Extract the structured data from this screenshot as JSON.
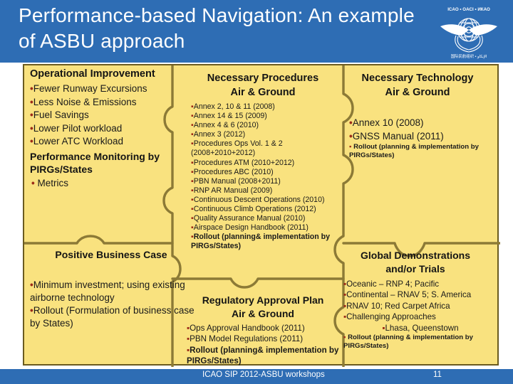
{
  "header": {
    "title": "Performance-based Navigation: An example of ASBU approach",
    "logo_icon": "icao-emblem-icon"
  },
  "colors": {
    "header_blue": "#2E6DB4",
    "panel_yellow": "#F9E27F",
    "panel_border": "#6B5B20",
    "bullet_red": "#9C2B17",
    "text_dark": "#141414"
  },
  "pieces": {
    "operational_improvement": {
      "heading": "Operational Improvement",
      "items": [
        "Fewer Runway Excursions",
        "Less Noise & Emissions",
        "Fuel Savings",
        "Lower Pilot workload",
        "Lower ATC Workload"
      ],
      "heading2": "Performance Monitoring by PIRGs/States",
      "items2": [
        "Metrics"
      ]
    },
    "business_case": {
      "heading": "Positive Business Case",
      "items": [
        "Minimum investment; using existing airborne technology",
        "Rollout (Formulation of business case by States)"
      ]
    },
    "necessary_procedures": {
      "heading_line1": "Necessary Procedures",
      "heading_line2": "Air & Ground",
      "items": [
        "Annex 2, 10 & 11 (2008)",
        "Annex 14 & 15 (2009)",
        "Annex 4 & 6 (2010)",
        "Annex 3 (2012)",
        "Procedures Ops Vol. 1 & 2 (2008+2010+2012)",
        "Procedures ATM (2010+2012)",
        "Procedures ABC (2010)",
        "PBN Manual (2008+2011)",
        "RNP AR Manual (2009)",
        "Continuous Descent Operations (2010)",
        "Continuous Climb Operations (2012)",
        "Quality Assurance Manual (2010)",
        "Airspace Design Handbook (2011)",
        "Rollout  (planning& implementation by PIRGs/States)"
      ]
    },
    "regulatory_approval": {
      "heading_line1": "Regulatory Approval Plan",
      "heading_line2": "Air & Ground",
      "items": [
        "Ops Approval Handbook (2011)",
        "PBN Model Regulations (2011)",
        "Rollout  (planning& implementation by PIRGs/States)"
      ]
    },
    "necessary_technology": {
      "heading_line1": "Necessary Technology",
      "heading_line2": "Air & Ground",
      "items": [
        "Annex 10 (2008)",
        "GNSS Manual (2011)",
        "Rollout  (planning & implementation by PIRGs/States)"
      ]
    },
    "global_demonstrations": {
      "heading_line1": "Global Demonstrations",
      "heading_line2": "and/or Trials",
      "items": [
        "Oceanic – RNP 4; Pacific",
        "Continental – RNAV 5; S. America",
        "RNAV 10; Red Carpet Africa",
        "Challenging Approaches",
        "Lhasa, Queenstown",
        "Rollout  (planning &  implementation by PIRGs/States)"
      ]
    }
  },
  "footer": {
    "text": "ICAO SIP 2012-ASBU workshops",
    "page": "11"
  }
}
